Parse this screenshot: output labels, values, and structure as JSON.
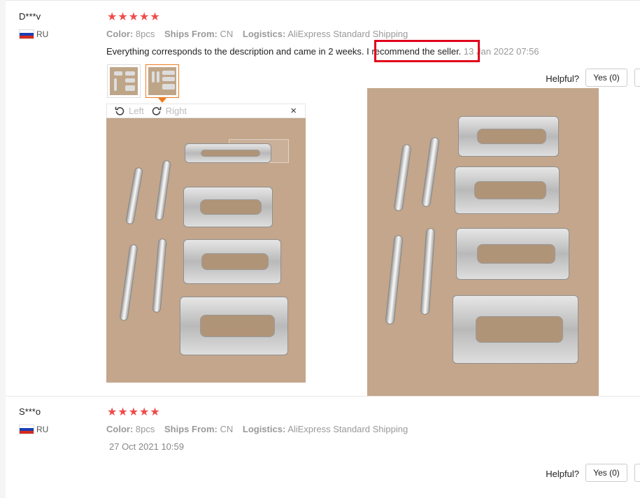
{
  "reviews": [
    {
      "username": "D***v",
      "country": "RU",
      "rating": 5,
      "color_label": "Color:",
      "color_value": "8pcs",
      "ships_label": "Ships From:",
      "ships_value": "CN",
      "logistics_label": "Logistics:",
      "logistics_value": "AliExpress Standard Shipping",
      "text_before": "Everything corresponds to the description and came in 2 weeks.",
      "text_highlight": "I recommend the seller.",
      "date": "13 Jan 2022 07:56",
      "rotate_left": "Left",
      "rotate_right": "Right",
      "close": "×",
      "helpful_label": "Helpful?",
      "yes_label": "Yes (0)"
    },
    {
      "username": "S***o",
      "country": "RU",
      "rating": 5,
      "color_label": "Color:",
      "color_value": "8pcs",
      "ships_label": "Ships From:",
      "ships_value": "CN",
      "logistics_label": "Logistics:",
      "logistics_value": "AliExpress Standard Shipping",
      "date": "27 Oct 2021 10:59",
      "helpful_label": "Helpful?",
      "yes_label": "Yes (0)"
    }
  ],
  "icons": {
    "star": "star-icon",
    "rotate_left": "rotate-left-icon",
    "rotate_right": "rotate-right-icon",
    "close": "close-icon",
    "flag": "russia-flag-icon"
  },
  "colors": {
    "star": "#f04b4b",
    "highlight_border": "#e0001b",
    "thumb_active": "#f07c1f"
  }
}
